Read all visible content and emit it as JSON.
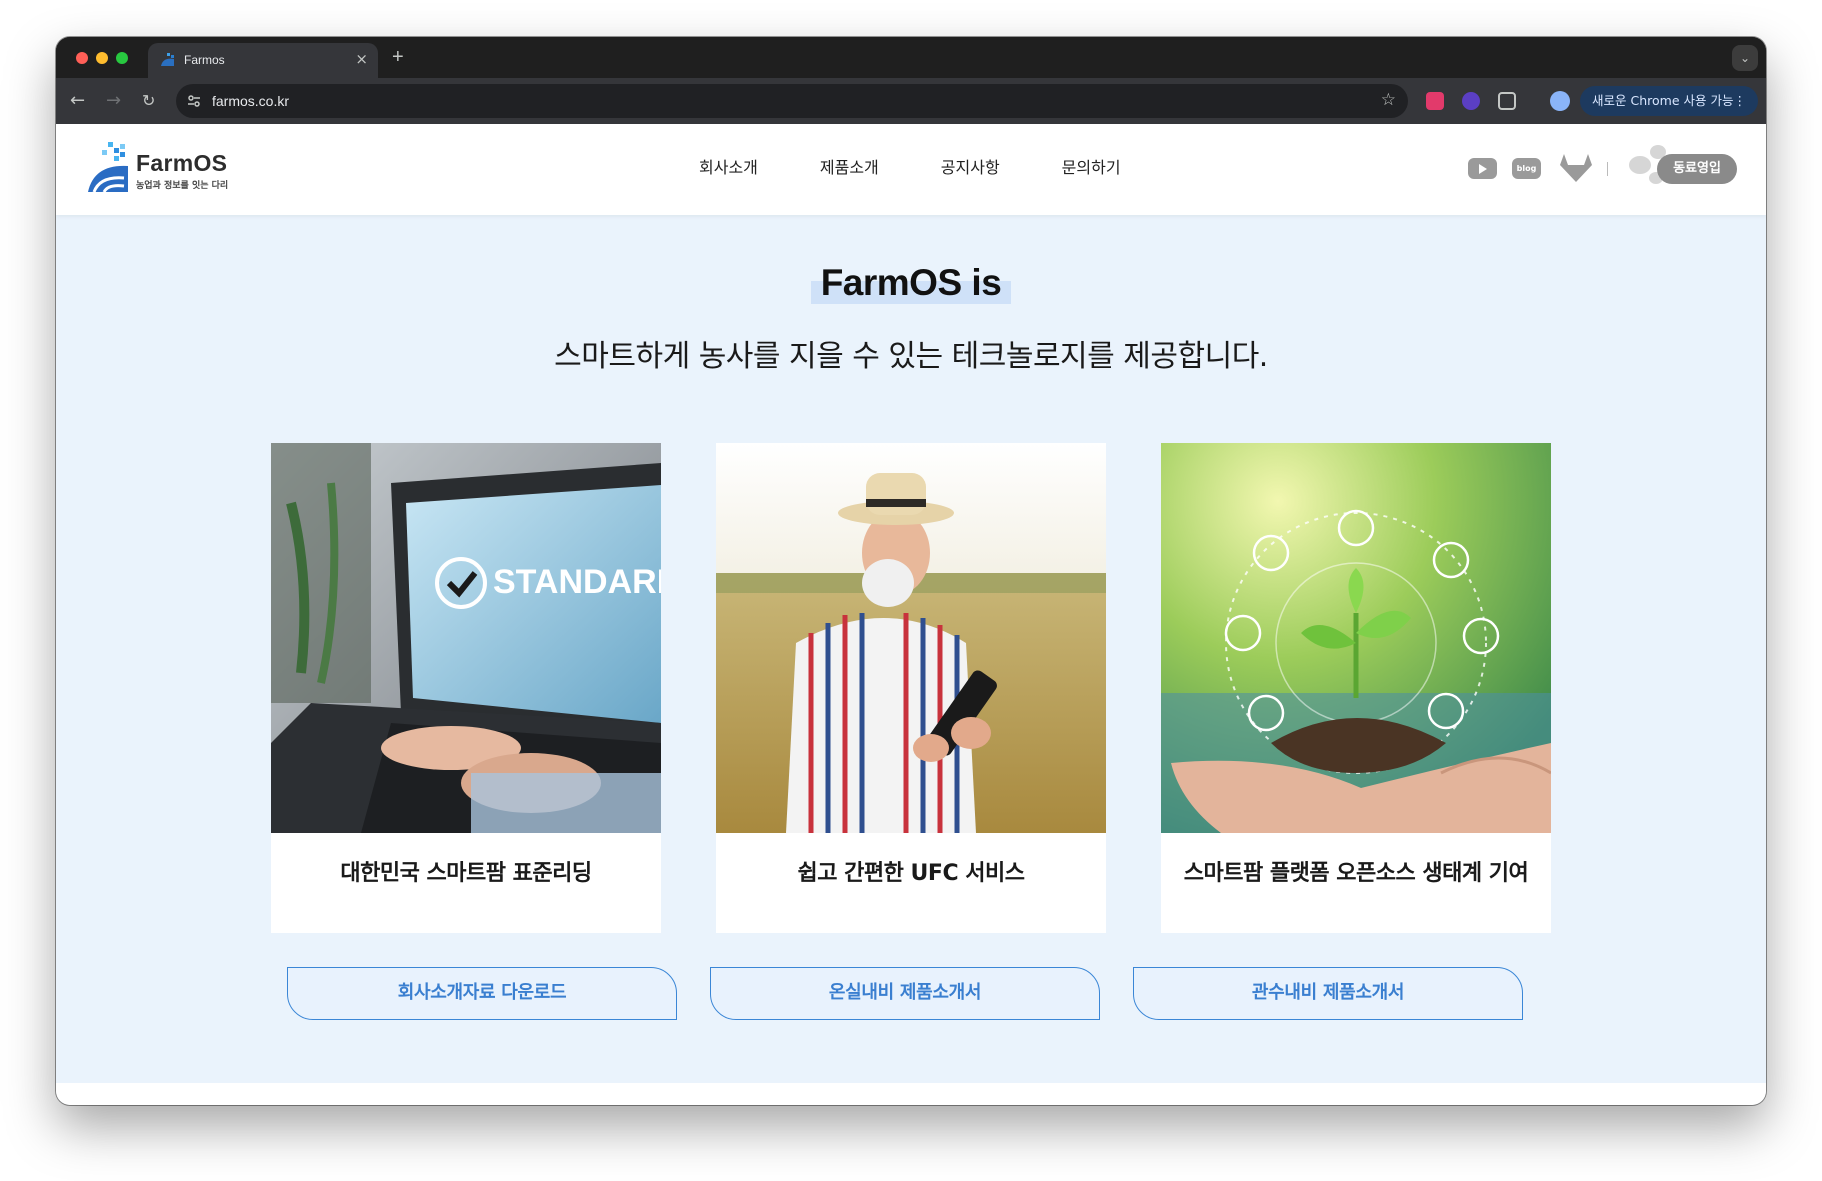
{
  "browser": {
    "tab_title": "Farmos",
    "url": "farmos.co.kr",
    "chrome_promo": "새로운 Chrome 사용 가능"
  },
  "site": {
    "logo": {
      "name": "FarmOS",
      "tagline": "농업과 정보를 잇는 다리"
    },
    "nav": [
      "회사소개",
      "제품소개",
      "공지사항",
      "문의하기"
    ],
    "social_icons": [
      "youtube-icon",
      "blog-icon",
      "gitlab-icon"
    ],
    "blog_label": "blog",
    "recruit_label": "동료영입"
  },
  "hero": {
    "title": "FarmOS is",
    "subtitle": "스마트하게 농사를 지을 수 있는 테크놀로지를 제공합니다."
  },
  "cards": [
    {
      "caption": "대한민국 스마트팜 표준리딩",
      "image": "laptop-standard-photo",
      "overlay_text": "STANDARD"
    },
    {
      "caption": "쉽고 간편한 UFC 서비스",
      "image": "farmer-tablet-photo"
    },
    {
      "caption": "스마트팜 플랫폼 오픈소스 생태계 기여",
      "image": "seedling-hand-photo"
    }
  ],
  "downloads": [
    {
      "label": "회사소개자료 다운로드"
    },
    {
      "label": "온실내비 제품소개서"
    },
    {
      "label": "관수내비 제품소개서"
    }
  ],
  "colors": {
    "accent": "#3a86d6",
    "page_bg": "#eaf3fc",
    "browser_chrome": "#35363a"
  }
}
